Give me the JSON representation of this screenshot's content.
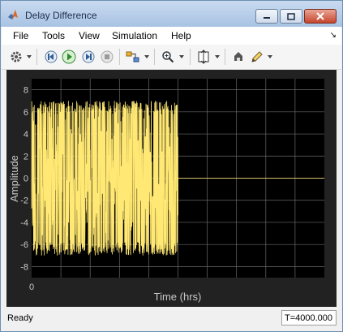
{
  "window": {
    "title": "Delay Difference"
  },
  "menu": [
    "File",
    "Tools",
    "View",
    "Simulation",
    "Help"
  ],
  "toolbar": {
    "icons": [
      "gear-icon",
      "step-back-icon",
      "run-icon",
      "step-forward-icon",
      "stop-icon",
      "signal-selector-icon",
      "zoom-icon",
      "autoscale-icon",
      "highlight-icon",
      "edit-icon"
    ]
  },
  "colors": {
    "trace": "#ffe873",
    "plot_bg": "#000000",
    "panel_bg": "#222222",
    "grid": "#6a6a6a"
  },
  "status": {
    "text": "Ready",
    "time": "T=4000.000"
  },
  "chart_data": {
    "type": "line",
    "xlabel": "Time (hrs)",
    "ylabel": "Amplitude",
    "ylim": [
      -9,
      9
    ],
    "yticks": [
      8,
      6,
      4,
      2,
      0,
      -2,
      -4,
      -6,
      -8
    ],
    "xticks": [
      "0"
    ],
    "grid": true,
    "series": [
      {
        "description": "noise",
        "active_fraction_of_x": 0.5,
        "peak": 7,
        "trough": -7,
        "after": 0
      }
    ]
  }
}
